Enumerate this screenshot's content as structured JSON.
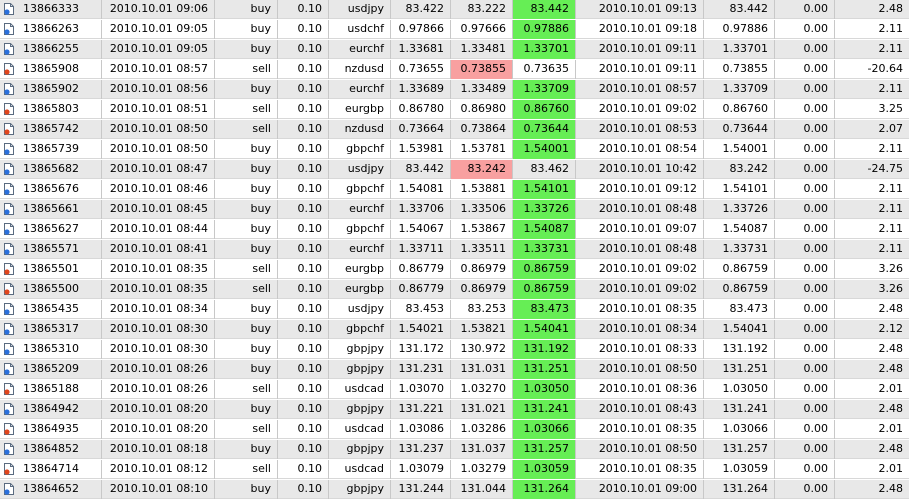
{
  "colors": {
    "row_odd": "#e8e8e8",
    "row_even": "#ffffff",
    "take_profit_hit": "#66ee55",
    "stop_loss_hit": "#f8a0a0",
    "buy_icon_dot": "#2a6fdb",
    "sell_icon_dot": "#e0441c"
  },
  "icons": {
    "buy": "buy-order-icon",
    "sell": "sell-order-icon"
  },
  "trades": [
    {
      "ticket": "13866333",
      "open_time": "2010.10.01 09:06",
      "type": "buy",
      "size": "0.10",
      "symbol": "usdjpy",
      "open_price": "83.422",
      "sl": "83.222",
      "tp": "83.442",
      "close_time": "2010.10.01 09:13",
      "close_price": "83.442",
      "commission": "0.00",
      "profit": "2.48",
      "hit": "tp"
    },
    {
      "ticket": "13866263",
      "open_time": "2010.10.01 09:05",
      "type": "buy",
      "size": "0.10",
      "symbol": "usdchf",
      "open_price": "0.97866",
      "sl": "0.97666",
      "tp": "0.97886",
      "close_time": "2010.10.01 09:18",
      "close_price": "0.97886",
      "commission": "0.00",
      "profit": "2.11",
      "hit": "tp"
    },
    {
      "ticket": "13866255",
      "open_time": "2010.10.01 09:05",
      "type": "buy",
      "size": "0.10",
      "symbol": "eurchf",
      "open_price": "1.33681",
      "sl": "1.33481",
      "tp": "1.33701",
      "close_time": "2010.10.01 09:11",
      "close_price": "1.33701",
      "commission": "0.00",
      "profit": "2.11",
      "hit": "tp"
    },
    {
      "ticket": "13865908",
      "open_time": "2010.10.01 08:57",
      "type": "sell",
      "size": "0.10",
      "symbol": "nzdusd",
      "open_price": "0.73655",
      "sl": "0.73855",
      "tp": "0.73635",
      "close_time": "2010.10.01 09:11",
      "close_price": "0.73855",
      "commission": "0.00",
      "profit": "-20.64",
      "hit": "sl"
    },
    {
      "ticket": "13865902",
      "open_time": "2010.10.01 08:56",
      "type": "buy",
      "size": "0.10",
      "symbol": "eurchf",
      "open_price": "1.33689",
      "sl": "1.33489",
      "tp": "1.33709",
      "close_time": "2010.10.01 08:57",
      "close_price": "1.33709",
      "commission": "0.00",
      "profit": "2.11",
      "hit": "tp"
    },
    {
      "ticket": "13865803",
      "open_time": "2010.10.01 08:51",
      "type": "sell",
      "size": "0.10",
      "symbol": "eurgbp",
      "open_price": "0.86780",
      "sl": "0.86980",
      "tp": "0.86760",
      "close_time": "2010.10.01 09:02",
      "close_price": "0.86760",
      "commission": "0.00",
      "profit": "3.25",
      "hit": "tp"
    },
    {
      "ticket": "13865742",
      "open_time": "2010.10.01 08:50",
      "type": "sell",
      "size": "0.10",
      "symbol": "nzdusd",
      "open_price": "0.73664",
      "sl": "0.73864",
      "tp": "0.73644",
      "close_time": "2010.10.01 08:53",
      "close_price": "0.73644",
      "commission": "0.00",
      "profit": "2.07",
      "hit": "tp"
    },
    {
      "ticket": "13865739",
      "open_time": "2010.10.01 08:50",
      "type": "buy",
      "size": "0.10",
      "symbol": "gbpchf",
      "open_price": "1.53981",
      "sl": "1.53781",
      "tp": "1.54001",
      "close_time": "2010.10.01 08:54",
      "close_price": "1.54001",
      "commission": "0.00",
      "profit": "2.11",
      "hit": "tp"
    },
    {
      "ticket": "13865682",
      "open_time": "2010.10.01 08:47",
      "type": "buy",
      "size": "0.10",
      "symbol": "usdjpy",
      "open_price": "83.442",
      "sl": "83.242",
      "tp": "83.462",
      "close_time": "2010.10.01 10:42",
      "close_price": "83.242",
      "commission": "0.00",
      "profit": "-24.75",
      "hit": "sl"
    },
    {
      "ticket": "13865676",
      "open_time": "2010.10.01 08:46",
      "type": "buy",
      "size": "0.10",
      "symbol": "gbpchf",
      "open_price": "1.54081",
      "sl": "1.53881",
      "tp": "1.54101",
      "close_time": "2010.10.01 09:12",
      "close_price": "1.54101",
      "commission": "0.00",
      "profit": "2.11",
      "hit": "tp"
    },
    {
      "ticket": "13865661",
      "open_time": "2010.10.01 08:45",
      "type": "buy",
      "size": "0.10",
      "symbol": "eurchf",
      "open_price": "1.33706",
      "sl": "1.33506",
      "tp": "1.33726",
      "close_time": "2010.10.01 08:48",
      "close_price": "1.33726",
      "commission": "0.00",
      "profit": "2.11",
      "hit": "tp"
    },
    {
      "ticket": "13865627",
      "open_time": "2010.10.01 08:44",
      "type": "buy",
      "size": "0.10",
      "symbol": "gbpchf",
      "open_price": "1.54067",
      "sl": "1.53867",
      "tp": "1.54087",
      "close_time": "2010.10.01 09:07",
      "close_price": "1.54087",
      "commission": "0.00",
      "profit": "2.11",
      "hit": "tp"
    },
    {
      "ticket": "13865571",
      "open_time": "2010.10.01 08:41",
      "type": "buy",
      "size": "0.10",
      "symbol": "eurchf",
      "open_price": "1.33711",
      "sl": "1.33511",
      "tp": "1.33731",
      "close_time": "2010.10.01 08:48",
      "close_price": "1.33731",
      "commission": "0.00",
      "profit": "2.11",
      "hit": "tp"
    },
    {
      "ticket": "13865501",
      "open_time": "2010.10.01 08:35",
      "type": "sell",
      "size": "0.10",
      "symbol": "eurgbp",
      "open_price": "0.86779",
      "sl": "0.86979",
      "tp": "0.86759",
      "close_time": "2010.10.01 09:02",
      "close_price": "0.86759",
      "commission": "0.00",
      "profit": "3.26",
      "hit": "tp"
    },
    {
      "ticket": "13865500",
      "open_time": "2010.10.01 08:35",
      "type": "sell",
      "size": "0.10",
      "symbol": "eurgbp",
      "open_price": "0.86779",
      "sl": "0.86979",
      "tp": "0.86759",
      "close_time": "2010.10.01 09:02",
      "close_price": "0.86759",
      "commission": "0.00",
      "profit": "3.26",
      "hit": "tp"
    },
    {
      "ticket": "13865435",
      "open_time": "2010.10.01 08:34",
      "type": "buy",
      "size": "0.10",
      "symbol": "usdjpy",
      "open_price": "83.453",
      "sl": "83.253",
      "tp": "83.473",
      "close_time": "2010.10.01 08:35",
      "close_price": "83.473",
      "commission": "0.00",
      "profit": "2.48",
      "hit": "tp"
    },
    {
      "ticket": "13865317",
      "open_time": "2010.10.01 08:30",
      "type": "buy",
      "size": "0.10",
      "symbol": "gbpchf",
      "open_price": "1.54021",
      "sl": "1.53821",
      "tp": "1.54041",
      "close_time": "2010.10.01 08:34",
      "close_price": "1.54041",
      "commission": "0.00",
      "profit": "2.12",
      "hit": "tp"
    },
    {
      "ticket": "13865310",
      "open_time": "2010.10.01 08:30",
      "type": "buy",
      "size": "0.10",
      "symbol": "gbpjpy",
      "open_price": "131.172",
      "sl": "130.972",
      "tp": "131.192",
      "close_time": "2010.10.01 08:33",
      "close_price": "131.192",
      "commission": "0.00",
      "profit": "2.48",
      "hit": "tp"
    },
    {
      "ticket": "13865209",
      "open_time": "2010.10.01 08:26",
      "type": "buy",
      "size": "0.10",
      "symbol": "gbpjpy",
      "open_price": "131.231",
      "sl": "131.031",
      "tp": "131.251",
      "close_time": "2010.10.01 08:50",
      "close_price": "131.251",
      "commission": "0.00",
      "profit": "2.48",
      "hit": "tp"
    },
    {
      "ticket": "13865188",
      "open_time": "2010.10.01 08:26",
      "type": "sell",
      "size": "0.10",
      "symbol": "usdcad",
      "open_price": "1.03070",
      "sl": "1.03270",
      "tp": "1.03050",
      "close_time": "2010.10.01 08:36",
      "close_price": "1.03050",
      "commission": "0.00",
      "profit": "2.01",
      "hit": "tp"
    },
    {
      "ticket": "13864942",
      "open_time": "2010.10.01 08:20",
      "type": "buy",
      "size": "0.10",
      "symbol": "gbpjpy",
      "open_price": "131.221",
      "sl": "131.021",
      "tp": "131.241",
      "close_time": "2010.10.01 08:43",
      "close_price": "131.241",
      "commission": "0.00",
      "profit": "2.48",
      "hit": "tp"
    },
    {
      "ticket": "13864935",
      "open_time": "2010.10.01 08:20",
      "type": "sell",
      "size": "0.10",
      "symbol": "usdcad",
      "open_price": "1.03086",
      "sl": "1.03286",
      "tp": "1.03066",
      "close_time": "2010.10.01 08:35",
      "close_price": "1.03066",
      "commission": "0.00",
      "profit": "2.01",
      "hit": "tp"
    },
    {
      "ticket": "13864852",
      "open_time": "2010.10.01 08:18",
      "type": "buy",
      "size": "0.10",
      "symbol": "gbpjpy",
      "open_price": "131.237",
      "sl": "131.037",
      "tp": "131.257",
      "close_time": "2010.10.01 08:50",
      "close_price": "131.257",
      "commission": "0.00",
      "profit": "2.48",
      "hit": "tp"
    },
    {
      "ticket": "13864714",
      "open_time": "2010.10.01 08:12",
      "type": "sell",
      "size": "0.10",
      "symbol": "usdcad",
      "open_price": "1.03079",
      "sl": "1.03279",
      "tp": "1.03059",
      "close_time": "2010.10.01 08:35",
      "close_price": "1.03059",
      "commission": "0.00",
      "profit": "2.01",
      "hit": "tp"
    },
    {
      "ticket": "13864652",
      "open_time": "2010.10.01 08:10",
      "type": "buy",
      "size": "0.10",
      "symbol": "gbpjpy",
      "open_price": "131.244",
      "sl": "131.044",
      "tp": "131.264",
      "close_time": "2010.10.01 09:00",
      "close_price": "131.264",
      "commission": "0.00",
      "profit": "2.48",
      "hit": "tp"
    }
  ]
}
